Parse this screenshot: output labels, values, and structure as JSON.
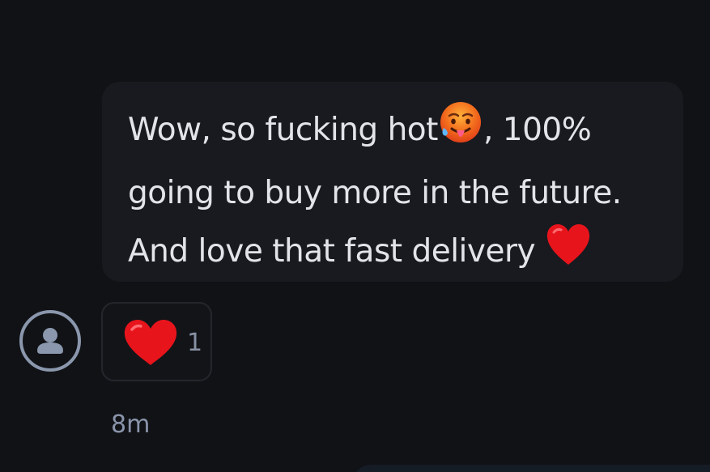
{
  "message": {
    "lines": [
      {
        "before": "Wow, so fucking hot",
        "emoji": "hot-face",
        "after": ", 100%"
      },
      {
        "before": "going to buy more in the future.",
        "emoji": "",
        "after": ""
      },
      {
        "before": "And love that fast delivery ",
        "emoji": "red-heart",
        "after": ""
      }
    ]
  },
  "reaction": {
    "emoji": "red-heart",
    "count": "1"
  },
  "timestamp": "8m",
  "colors": {
    "background": "#111216",
    "bubble": "#191a1f",
    "text": "#e2e4ea",
    "muted": "#8a94aa",
    "heart": "#e8141c",
    "hot_face": "#f26a1c"
  }
}
